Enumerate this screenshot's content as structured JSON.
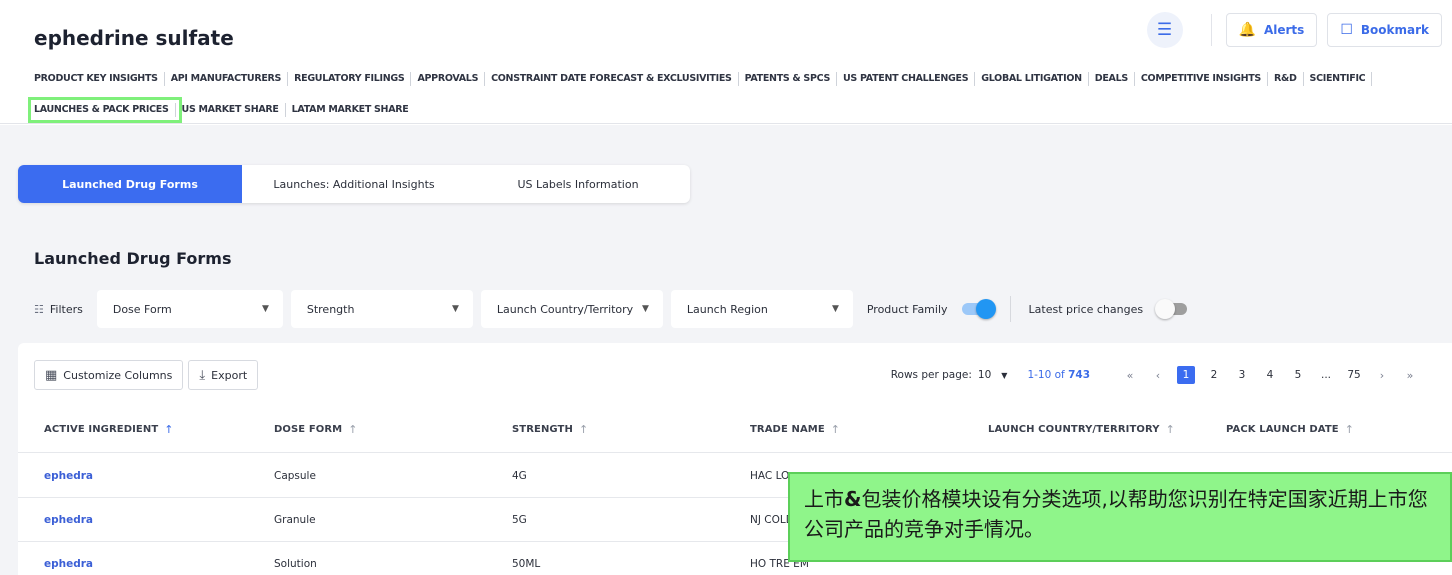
{
  "header": {
    "title": "ephedrine sulfate",
    "alerts_label": "Alerts",
    "bookmark_label": "Bookmark"
  },
  "nav": {
    "row1": [
      "PRODUCT KEY INSIGHTS",
      "API MANUFACTURERS",
      "REGULATORY FILINGS",
      "APPROVALS",
      "CONSTRAINT DATE FORECAST & EXCLUSIVITIES",
      "PATENTS & SPCS",
      "US PATENT CHALLENGES",
      "GLOBAL LITIGATION",
      "DEALS",
      "COMPETITIVE INSIGHTS",
      "R&D",
      "SCIENTIFIC"
    ],
    "row2": [
      "LAUNCHES & PACK PRICES",
      "US MARKET SHARE",
      "LATAM MARKET SHARE"
    ]
  },
  "tabs": [
    "Launched Drug Forms",
    "Launches: Additional Insights",
    "US Labels Information"
  ],
  "section_title": "Launched Drug Forms",
  "filters": {
    "label": "Filters",
    "dropdowns": [
      "Dose Form",
      "Strength",
      "Launch Country/Territory",
      "Launch Region"
    ],
    "product_family_label": "Product Family",
    "latest_price_label": "Latest price changes"
  },
  "table_tools": {
    "customize_label": "Customize Columns",
    "export_label": "Export"
  },
  "pager": {
    "rows_per_page_label": "Rows per page:",
    "rows_per_page_value": "10",
    "range_prefix": "1-10 of ",
    "range_total": "743",
    "pages": [
      "1",
      "2",
      "3",
      "4",
      "5",
      "...",
      "75"
    ]
  },
  "columns": [
    "ACTIVE INGREDIENT",
    "DOSE FORM",
    "STRENGTH",
    "TRADE NAME",
    "LAUNCH COUNTRY/TERRITORY",
    "PACK LAUNCH DATE"
  ],
  "rows": [
    {
      "ingredient": "ephedra",
      "dose_form": "Capsule",
      "strength": "4G",
      "trade_name": "HAC LO"
    },
    {
      "ingredient": "ephedra",
      "dose_form": "Granule",
      "strength": "5G",
      "trade_name": "NJ COLD"
    },
    {
      "ingredient": "ephedra",
      "dose_form": "Solution",
      "strength": "50ML",
      "trade_name": "HO TRE EM"
    }
  ],
  "callout": {
    "text_part1": "上市",
    "text_amp": "&",
    "text_part2": "包装价格模块设有分类选项,以帮助您识别在特定国家近期上市您公司产品的竞争对手情况。"
  },
  "colors": {
    "accent": "#3b6cf0",
    "callout_bg": "#8ff58a",
    "highlight_outline": "#7ff07b"
  }
}
